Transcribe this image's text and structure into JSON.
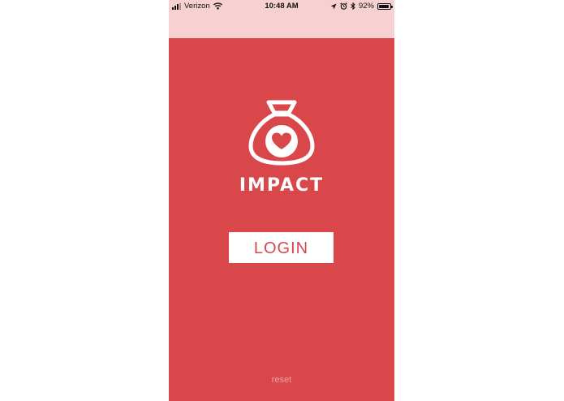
{
  "status_bar": {
    "carrier": "Verizon",
    "time": "10:48 AM",
    "battery_text": "92%",
    "battery_level": 0.92,
    "icons": [
      "signal-icon",
      "wifi-icon",
      "location-icon",
      "alarm-icon",
      "bluetooth-icon",
      "battery-icon"
    ]
  },
  "app": {
    "brand_name": "IMPACT",
    "logo_icon": "money-bag-heart-icon",
    "login_label": "LOGIN",
    "reset_label": "reset"
  },
  "colors": {
    "background": "#d9474b",
    "status_bar_background": "#f7d0d1",
    "button_background": "#ffffff",
    "button_text": "#d9474b",
    "reset_text": "#eba3a5"
  }
}
